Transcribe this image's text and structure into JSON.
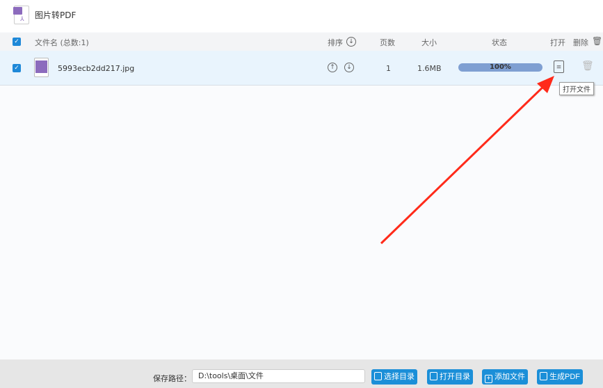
{
  "app": {
    "title": "图片转PDF"
  },
  "table": {
    "headers": {
      "name": "文件名 (总数:1)",
      "sort": "排序",
      "pages": "页数",
      "size": "大小",
      "status": "状态",
      "open": "打开",
      "delete": "删除"
    },
    "rows": [
      {
        "name": "5993ecb2dd217.jpg",
        "pages": "1",
        "size": "1.6MB",
        "progress": "100%",
        "progress_value": 100
      }
    ]
  },
  "tooltip": "打开文件",
  "footer": {
    "path_label": "保存路径：",
    "path_value": "D:\\tools\\桌面\\文件",
    "buttons": [
      "选择目录",
      "打开目录",
      "添加文件",
      "生成PDF"
    ]
  },
  "colors": {
    "accent": "#1b8fd8",
    "progress": "#7f9fd2",
    "arrow": "#ff2a1a"
  }
}
